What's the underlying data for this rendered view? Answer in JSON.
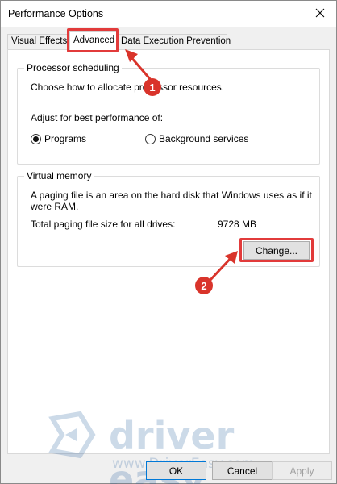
{
  "window": {
    "title": "Performance Options",
    "close_icon": "close-icon"
  },
  "tabs": [
    {
      "label": "Visual Effects"
    },
    {
      "label": "Advanced",
      "selected": true
    },
    {
      "label": "Data Execution Prevention"
    }
  ],
  "processor": {
    "legend": "Processor scheduling",
    "description": "Choose how to allocate processor resources.",
    "adjust_label": "Adjust for best performance of:",
    "options": [
      {
        "label": "Programs",
        "checked": true
      },
      {
        "label": "Background services",
        "checked": false
      }
    ]
  },
  "virtual_memory": {
    "legend": "Virtual memory",
    "description_line1": "A paging file is an area on the hard disk that Windows uses as if it",
    "description_line2": "were RAM.",
    "total_label": "Total paging file size for all drives:",
    "total_value": "9728 MB",
    "change_button": "Change..."
  },
  "annotations": {
    "step1": "1",
    "step2": "2",
    "highlight_color": "#e23b3b",
    "badge_color": "#d9342b"
  },
  "watermark": {
    "brand": "driver easy",
    "url": "www.DriverEasy.com"
  },
  "footer": {
    "ok": "OK",
    "cancel": "Cancel",
    "apply": "Apply"
  }
}
